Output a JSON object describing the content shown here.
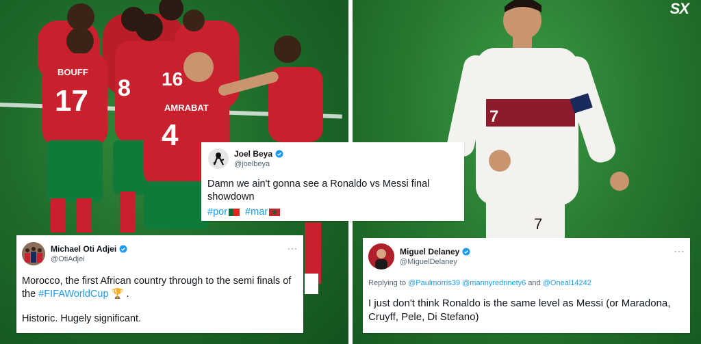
{
  "watermark": "SX",
  "left_photo": {
    "players": [
      {
        "name": "BOUFF",
        "number": "17"
      },
      {
        "name": "",
        "number": "8"
      },
      {
        "name": "",
        "number": "16"
      },
      {
        "name": "AMRABAT",
        "number": "4"
      }
    ]
  },
  "right_photo": {
    "player_number": "7",
    "shorts_number": "7"
  },
  "tweets": {
    "joel": {
      "name": "Joel Beya",
      "handle": "@joelbeya",
      "text": "Damn we ain't gonna see a Ronaldo vs Messi final showdown",
      "hashtag1": "#por",
      "hashtag2": "#mar"
    },
    "michael": {
      "name": "Michael Oti Adjei",
      "handle": "@OtiAdjei",
      "text_pre": "Morocco,  the first African country through to the semi finals of the ",
      "hashtag": "#FIFAWorldCup",
      "text_post": "🏆 .",
      "text2": "Historic. Hugely significant.",
      "more": "···"
    },
    "miguel": {
      "name": "Miguel Delaney",
      "handle": "@MiguelDelaney",
      "replying_prefix": "Replying to",
      "reply1": "@Paulmorris39",
      "reply2": "@mannyrednnety6",
      "reply_and": "and",
      "reply3": "@Oneal14242",
      "text": "I just don't think Ronaldo is the same level as Messi (or Maradona, Cruyff, Pele, Di Stefano)",
      "more": "···"
    }
  },
  "colors": {
    "twitter_blue": "#1d9bf0",
    "morocco_red": "#c8202c",
    "morocco_green": "#0f7a3a",
    "portugal_red": "#8e1b2b"
  }
}
